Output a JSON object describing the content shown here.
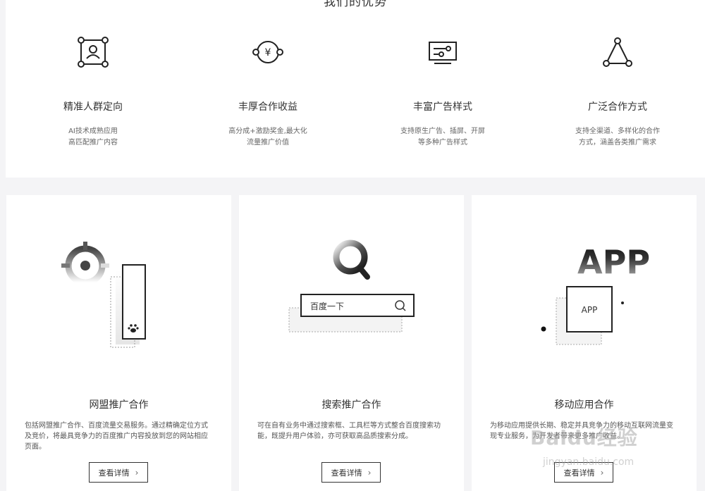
{
  "advantages": {
    "title": "我们的优势",
    "items": [
      {
        "icon": "target-user-icon",
        "title": "精准人群定向",
        "desc1": "AI技术成熟应用",
        "desc2": "高匹配推广内容"
      },
      {
        "icon": "yuan-coin-icon",
        "title": "丰厚合作收益",
        "desc1": "高分成+激励奖金,最大化",
        "desc2": "流量推广价值"
      },
      {
        "icon": "monitor-icon",
        "title": "丰富广告样式",
        "desc1": "支持原生广告、插屏、开屏",
        "desc2": "等多种广告样式"
      },
      {
        "icon": "triangle-nodes-icon",
        "title": "广泛合作方式",
        "desc1": "支持全渠道、多样化的合作",
        "desc2": "方式，涵盖各类推广需求"
      }
    ]
  },
  "cards": [
    {
      "title": "网盟推广合作",
      "desc": "包括网盟推广合作、百度流量交易服务。通过精确定位方式及竞价，将最具竞争力的百度推广内容投放到您的网站相应页面。",
      "button": "查看详情"
    },
    {
      "title": "搜索推广合作",
      "desc": "可在自有业务中通过搜索框、工具栏等方式整合百度搜索功能，既提升用户体验，亦可获取高品质搜索分成。",
      "button": "查看详情",
      "search_text": "百度一下"
    },
    {
      "title": "移动应用合作",
      "desc": "为移动应用提供长期、稳定并具竞争力的移动互联网流量变现专业服务，为开发者带来更多推广收益。",
      "button": "查看详情",
      "app_big": "APP",
      "app_small": "APP"
    }
  ],
  "watermark": {
    "text": "Baidu经验",
    "sub": "jingyan.baidu.com"
  }
}
